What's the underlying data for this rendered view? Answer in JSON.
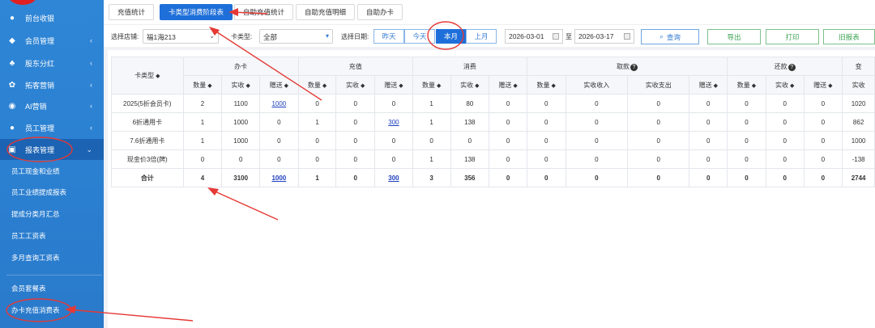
{
  "sidebar": {
    "items": [
      {
        "label": "前台收银",
        "icon": "money-bag-icon"
      },
      {
        "label": "会员管理",
        "icon": "diamond-icon"
      },
      {
        "label": "股东分红",
        "icon": "shareholder-icon"
      },
      {
        "label": "拓客营销",
        "icon": "paw-icon"
      },
      {
        "label": "AI营销",
        "icon": "ai-icon"
      },
      {
        "label": "员工管理",
        "icon": "user-icon"
      },
      {
        "label": "报表管理",
        "icon": "report-icon"
      }
    ],
    "sub_items": [
      "员工现金和业绩",
      "员工业绩提成报表",
      "提成分类月汇总",
      "员工工资表",
      "多月查询工资表",
      "会员套餐表",
      "办卡充值消费表"
    ]
  },
  "tabs": [
    "充值统计",
    "卡类型消费阶段表",
    "自助充值统计",
    "自助充值明细",
    "自助办卡"
  ],
  "filter": {
    "store_label": "选择店铺:",
    "store_value": "福1海213",
    "card_type_label": "卡类型:",
    "card_type_value": "全部",
    "date_label": "选择日期:",
    "date_buttons": [
      "昨天",
      "今天",
      "本月",
      "上月"
    ],
    "date_from": "2026-03-01",
    "date_sep": "至",
    "date_to": "2026-03-17",
    "query": "查询",
    "export": "导出",
    "print": "打印",
    "old_report": "旧报表"
  },
  "table": {
    "card_type_header": "卡类型",
    "groups": [
      "办卡",
      "充值",
      "消费",
      "取款",
      "还款",
      "变"
    ],
    "sub_headers": [
      "数量",
      "实收",
      "赠送",
      "数量",
      "实收",
      "赠送",
      "数量",
      "实收",
      "赠送",
      "数量",
      "实收收入",
      "实收支出",
      "赠送",
      "数量",
      "实收",
      "赠送",
      "实收"
    ],
    "rows": [
      [
        "2025(5折会员卡)",
        "2",
        "1100",
        "1000",
        "0",
        "0",
        "0",
        "1",
        "80",
        "0",
        "0",
        "0",
        "0",
        "0",
        "0",
        "0",
        "0",
        "1020"
      ],
      [
        "6折通用卡",
        "1",
        "1000",
        "0",
        "1",
        "0",
        "300",
        "1",
        "138",
        "0",
        "0",
        "0",
        "0",
        "0",
        "0",
        "0",
        "0",
        "862"
      ],
      [
        "7.6折通用卡",
        "1",
        "1000",
        "0",
        "0",
        "0",
        "0",
        "0",
        "0",
        "0",
        "0",
        "0",
        "0",
        "0",
        "0",
        "0",
        "0",
        "1000"
      ],
      [
        "现金价3倍(牌)",
        "0",
        "0",
        "0",
        "0",
        "0",
        "0",
        "1",
        "138",
        "0",
        "0",
        "0",
        "0",
        "0",
        "0",
        "0",
        "0",
        "-138"
      ],
      [
        "合计",
        "4",
        "3100",
        "1000",
        "1",
        "0",
        "300",
        "3",
        "356",
        "0",
        "0",
        "0",
        "0",
        "0",
        "0",
        "0",
        "0",
        "2744"
      ]
    ]
  },
  "colors": {
    "sidebar": "#2b7fd0",
    "accent": "#1e6fd9",
    "annotation": "#e53935"
  }
}
